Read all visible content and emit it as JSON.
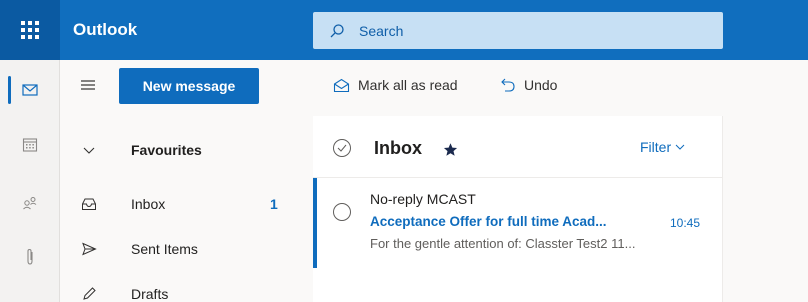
{
  "app": {
    "name": "Outlook"
  },
  "search": {
    "placeholder": "Search"
  },
  "nav": {
    "new_message": "New message",
    "favourites": "Favourites",
    "items": [
      {
        "label": "Inbox",
        "count": "1"
      },
      {
        "label": "Sent Items"
      },
      {
        "label": "Drafts"
      }
    ]
  },
  "commands": {
    "mark_all_read": "Mark all as read",
    "undo": "Undo"
  },
  "list": {
    "folder": "Inbox",
    "filter": "Filter"
  },
  "messages": [
    {
      "sender": "No-reply MCAST",
      "subject": "Acceptance Offer for full time Acad...",
      "time": "10:45",
      "preview": "For the gentle attention of: Classter Test2 11..."
    }
  ],
  "colors": {
    "brand": "#106ebe",
    "accent": "#0f6cbd",
    "search_bg": "#c7e0f4"
  }
}
